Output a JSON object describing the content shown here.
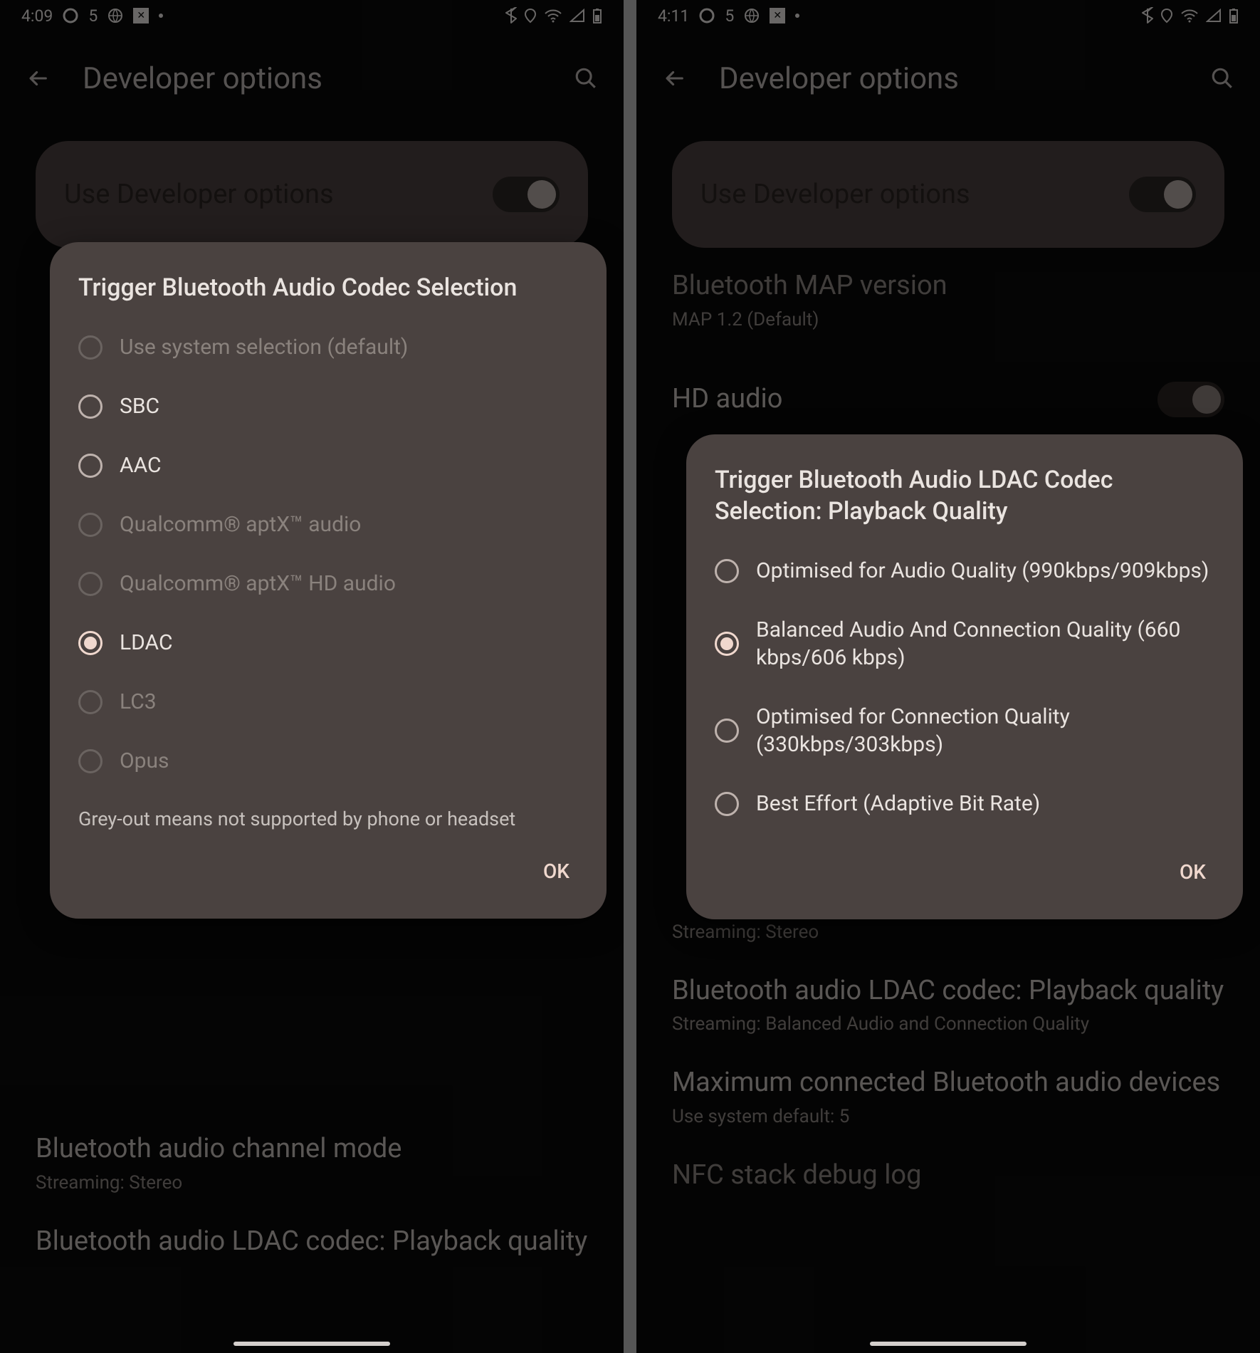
{
  "left": {
    "status": {
      "time": "4:09",
      "notif_count": "5"
    },
    "appbar": {
      "title": "Developer options"
    },
    "pill": {
      "label": "Use Developer options"
    },
    "settings": [
      {
        "title": "Bluetooth audio channel mode",
        "sub": "Streaming: Stereo"
      },
      {
        "title": "Bluetooth audio LDAC codec: Playback quality",
        "sub": ""
      }
    ],
    "dialog": {
      "title": "Trigger Bluetooth Audio Codec Selection",
      "options": [
        {
          "label": "Use system selection (default)",
          "state": "disabled"
        },
        {
          "label": "SBC",
          "state": "enabled"
        },
        {
          "label": "AAC",
          "state": "enabled"
        },
        {
          "label": "Qualcomm® aptX™ audio",
          "state": "disabled"
        },
        {
          "label": "Qualcomm® aptX™ HD audio",
          "state": "disabled"
        },
        {
          "label": "LDAC",
          "state": "checked"
        },
        {
          "label": "LC3",
          "state": "disabled"
        },
        {
          "label": "Opus",
          "state": "disabled"
        }
      ],
      "note": "Grey-out means not supported by phone or headset",
      "ok": "OK"
    }
  },
  "right": {
    "status": {
      "time": "4:11",
      "notif_count": "5"
    },
    "appbar": {
      "title": "Developer options"
    },
    "pill": {
      "label": "Use Developer options"
    },
    "settings_above": [
      {
        "title": "Bluetooth MAP version",
        "sub": "MAP 1.2 (Default)"
      },
      {
        "title_partial": "HD audio"
      }
    ],
    "settings_below": [
      {
        "sub": "Streaming: Stereo"
      },
      {
        "title": "Bluetooth audio LDAC codec: Playback quality",
        "sub": "Streaming: Balanced Audio and Connection Quality"
      },
      {
        "title": "Maximum connected Bluetooth audio devices",
        "sub": "Use system default: 5"
      },
      {
        "title_partial": "NFC stack debug log"
      }
    ],
    "dialog": {
      "title": "Trigger Bluetooth Audio LDAC Codec Selection: Playback Quality",
      "options": [
        {
          "label": "Optimised for Audio Quality (990kbps/909kbps)",
          "state": "enabled"
        },
        {
          "label": "Balanced Audio And Connection Quality (660 kbps/606 kbps)",
          "state": "checked"
        },
        {
          "label": "Optimised for Connection Quality (330kbps/303kbps)",
          "state": "enabled"
        },
        {
          "label": "Best Effort (Adaptive Bit Rate)",
          "state": "enabled"
        }
      ],
      "ok": "OK"
    }
  }
}
